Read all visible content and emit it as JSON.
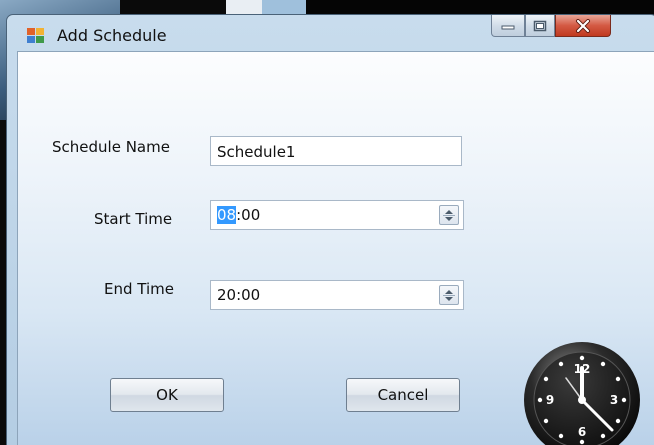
{
  "window": {
    "title": "Add Schedule"
  },
  "form": {
    "schedule_name_label": "Schedule Name",
    "schedule_name_value": "Schedule1",
    "start_time_label": "Start Time",
    "start_time_selected": "08",
    "start_time_rest": ":00",
    "end_time_label": "End Time",
    "end_time_value": "20:00"
  },
  "buttons": {
    "ok": "OK",
    "cancel": "Cancel"
  },
  "clock": {
    "numerals": [
      "12",
      "3",
      "6",
      "9"
    ]
  },
  "colors": {
    "selection": "#3399ff",
    "close_button": "#c0391f",
    "window_frame": "#b4cde3"
  },
  "icons": {
    "app": "schedule-app-icon",
    "minimize": "minimize-icon",
    "maximize": "maximize-icon",
    "close": "close-icon",
    "spin": "spin-arrows-icon",
    "clock": "wall-clock-icon"
  }
}
